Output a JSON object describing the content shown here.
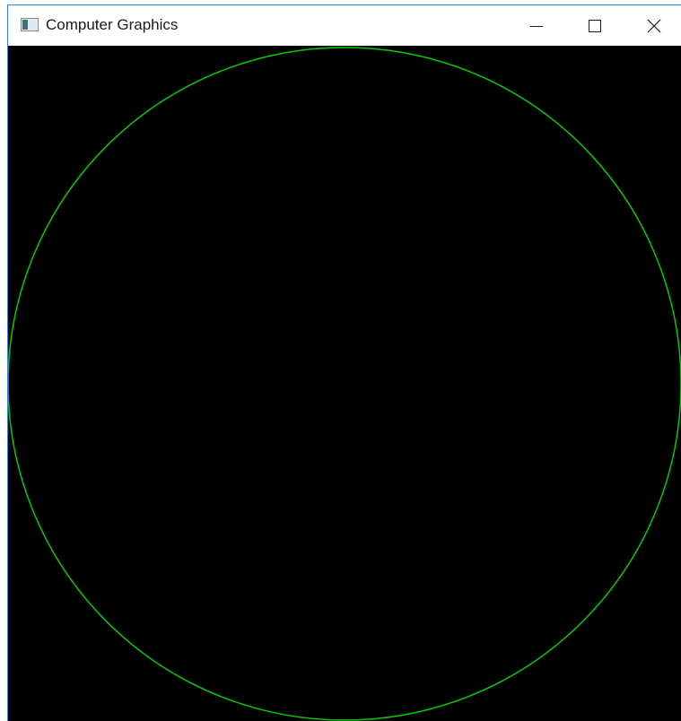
{
  "window": {
    "title": "Computer Graphics",
    "icon": "app-window-icon",
    "controls": [
      {
        "name": "minimize",
        "icon": "minimize-icon"
      },
      {
        "name": "maximize",
        "icon": "maximize-icon"
      },
      {
        "name": "close",
        "icon": "close-icon"
      }
    ]
  },
  "canvas": {
    "background": "#000000",
    "shapes": [
      {
        "type": "circle",
        "stroke": "#00cc00"
      }
    ]
  }
}
